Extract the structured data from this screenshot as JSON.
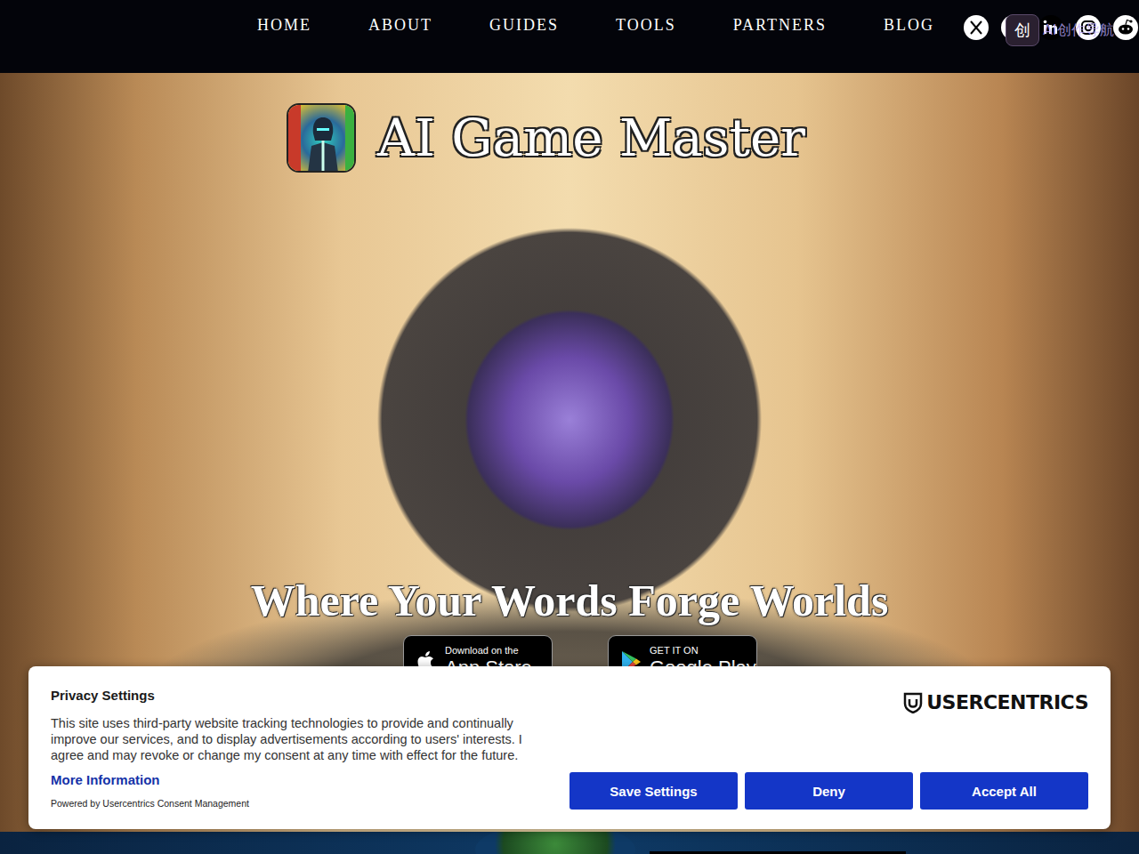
{
  "nav": {
    "items": [
      "HOME",
      "ABOUT",
      "GUIDES",
      "TOOLS",
      "PARTNERS",
      "BLOG"
    ]
  },
  "watermark": {
    "badge": "创",
    "text": "AI创作导航"
  },
  "hero": {
    "title": "AI Game Master",
    "tagline": "Where Your Words Forge Worlds",
    "stores": [
      {
        "small": "Download on the",
        "big": "App Store"
      },
      {
        "small": "GET IT ON",
        "big": "Google Play"
      }
    ]
  },
  "consent": {
    "title": "Privacy Settings",
    "body": "This site uses third-party website tracking technologies to provide and continually improve our services, and to display advertisements according to users' interests. I agree and may revoke or change my consent at any time with effect for the future.",
    "link": "More Information",
    "powered": "Powered by Usercentrics Consent Management",
    "brand": "USERCENTRICS",
    "buttons": [
      "Save Settings",
      "Deny",
      "Accept All"
    ]
  }
}
